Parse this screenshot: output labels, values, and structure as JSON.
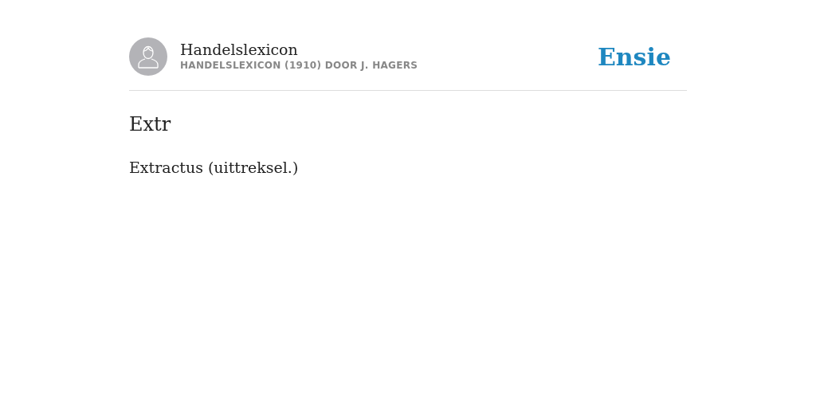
{
  "header": {
    "title": "Handelslexicon",
    "subtitle": "HANDELSLEXICON (1910) DOOR J. HAGERS",
    "logo": "Ensie"
  },
  "entry": {
    "term": "Extr",
    "definition": "Extractus (uittreksel.)"
  }
}
